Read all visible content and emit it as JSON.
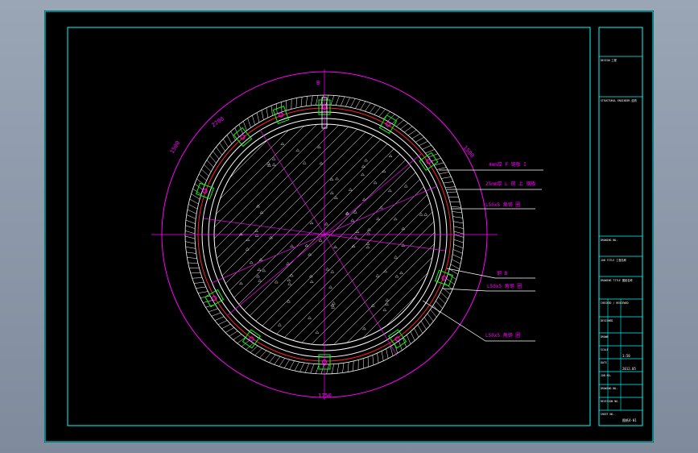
{
  "colors": {
    "viewport_bg": "#8e9aab",
    "sheet_bg": "#000000",
    "frame": "#00ffff",
    "circle": "#ff00ff",
    "structure": "#ffffff",
    "red_ring": "#ff2020",
    "bracket": "#00ff00",
    "leader": "#ffffff"
  },
  "drawing": {
    "top_marker": "B",
    "dimensions": {
      "top_left_arc": "2700",
      "left_arc": "1500",
      "right_arc": "1500",
      "bottom": "1750"
    },
    "callouts": [
      "4mm厚 F 钢板 I",
      "25mm厚 L 钢 上 钢板",
      "L50x5 角钢 圈",
      "钢 B",
      "L50x5 角钢 圈",
      "L50x5 角钢 圈"
    ]
  },
  "title_block": {
    "rows": [
      "DESIGN 工程",
      "STRUCTURAL ENGINEER 结构",
      "DRAWING NO.",
      "JOB TITLE 工程名称",
      "DRAWING TITLE 图纸名称",
      "CHECKED / REVIEWED",
      "DESIGNED",
      "DRAWN",
      "SCALE",
      "DATE",
      "JOB NO.",
      "DRAWING NO.",
      "REVISION NO.",
      "SHEET NO."
    ],
    "values": {
      "scale": "1:50",
      "date": "2012.05",
      "sheet": "图纸4-01"
    }
  }
}
